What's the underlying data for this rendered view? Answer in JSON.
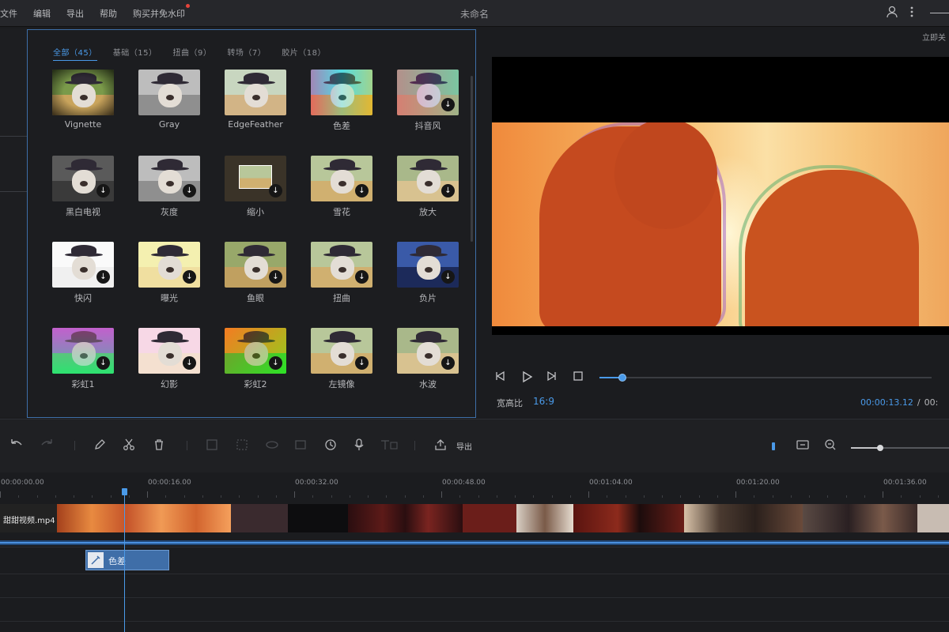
{
  "menu": [
    "文件",
    "编辑",
    "导出",
    "帮助",
    "购买并免水印"
  ],
  "window": {
    "title": "未命名",
    "user_icon": "user-icon",
    "more_icon": "more-icon"
  },
  "effects_panel": {
    "tabs": [
      {
        "label": "全部（45）",
        "active": true
      },
      {
        "label": "基础（15）",
        "active": false
      },
      {
        "label": "扭曲（9）",
        "active": false
      },
      {
        "label": "转场（7）",
        "active": false
      },
      {
        "label": "胶片（18）",
        "active": false
      }
    ],
    "items": [
      {
        "label": "Vignette",
        "tint": "vignette",
        "download": false
      },
      {
        "label": "Gray",
        "tint": "gray",
        "download": false
      },
      {
        "label": "EdgeFeather",
        "tint": "edge",
        "download": false
      },
      {
        "label": "色差",
        "tint": "rgbsplit",
        "download": false
      },
      {
        "label": "抖音风",
        "tint": "tiktok",
        "download": true
      },
      {
        "label": "黑白电视",
        "tint": "bwtv",
        "download": true
      },
      {
        "label": "灰度",
        "tint": "gray",
        "download": true
      },
      {
        "label": "缩小",
        "tint": "shrink",
        "download": true
      },
      {
        "label": "雪花",
        "tint": "warm",
        "download": true
      },
      {
        "label": "放大",
        "tint": "zoom",
        "download": true
      },
      {
        "label": "快闪",
        "tint": "flash",
        "download": true
      },
      {
        "label": "曝光",
        "tint": "exposure",
        "download": true
      },
      {
        "label": "鱼眼",
        "tint": "fisheye",
        "download": true
      },
      {
        "label": "扭曲",
        "tint": "warm",
        "download": true
      },
      {
        "label": "负片",
        "tint": "negative",
        "download": true
      },
      {
        "label": "彩虹1",
        "tint": "rainbow",
        "download": true
      },
      {
        "label": "幻影",
        "tint": "pink",
        "download": true
      },
      {
        "label": "彩虹2",
        "tint": "rainbow2",
        "download": true
      },
      {
        "label": "左镜像",
        "tint": "mirror",
        "download": true
      },
      {
        "label": "水波",
        "tint": "wave",
        "download": true
      }
    ]
  },
  "preview": {
    "close_label": "立即关",
    "aspect_label": "宽高比",
    "aspect_value": "16:9",
    "current_time": "00:00:13.12",
    "separator": "/",
    "total_time": "00:",
    "progress": 0.07
  },
  "toolbar": {
    "export_label": "导出",
    "zoom": 0.3
  },
  "timeline": {
    "ticks": [
      "00:00:00.00",
      "00:00:16.00",
      "00:00:32.00",
      "00:00:48.00",
      "00:01:04.00",
      "00:01:20.00",
      "00:01:36.00"
    ],
    "video_clip_label": "甜甜视频.mp4",
    "fx_clip_label": "色差"
  }
}
